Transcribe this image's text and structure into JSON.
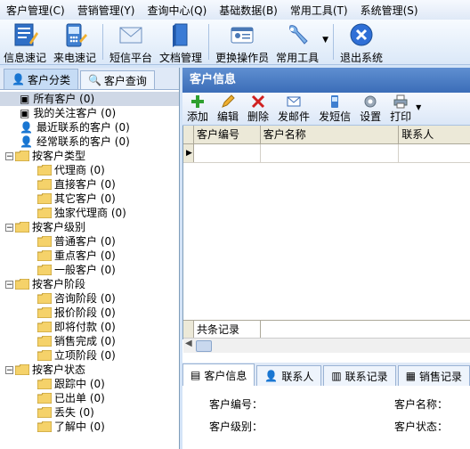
{
  "menu": [
    "客户管理(C)",
    "营销管理(Y)",
    "查询中心(Q)",
    "基础数据(B)",
    "常用工具(T)",
    "系统管理(S)"
  ],
  "toolbar": {
    "buttons": [
      {
        "label": "信息速记",
        "icon": "note-pen-icon"
      },
      {
        "label": "来电速记",
        "icon": "phone-icon"
      },
      {
        "label": "短信平台",
        "icon": "envelope-icon"
      },
      {
        "label": "文档管理",
        "icon": "document-icon"
      },
      {
        "label": "更换操作员",
        "icon": "id-card-icon"
      },
      {
        "label": "常用工具",
        "icon": "wrench-icon"
      },
      {
        "label": "退出系统",
        "icon": "exit-icon"
      }
    ]
  },
  "left_tabs": [
    "客户分类",
    "客户查询"
  ],
  "tree": {
    "top": [
      "所有客户 (0)",
      "我的关注客户 (0)",
      "最近联系的客户 (0)",
      "经常联系的客户 (0)"
    ],
    "groups": [
      {
        "title": "按客户类型",
        "children": [
          "代理商 (0)",
          "直接客户 (0)",
          "其它客户 (0)",
          "独家代理商 (0)"
        ]
      },
      {
        "title": "按客户级别",
        "children": [
          "普通客户 (0)",
          "重点客户 (0)",
          "一般客户 (0)"
        ]
      },
      {
        "title": "按客户阶段",
        "children": [
          "咨询阶段 (0)",
          "报价阶段 (0)",
          "即将付款 (0)",
          "销售完成 (0)",
          "立项阶段 (0)"
        ]
      },
      {
        "title": "按客户状态",
        "children": [
          "跟踪中 (0)",
          "已出单 (0)",
          "丢失 (0)",
          "了解中 (0)"
        ]
      }
    ]
  },
  "right_panel": {
    "title": "客户信息",
    "tools": [
      {
        "label": "添加",
        "icon": "plus-icon"
      },
      {
        "label": "编辑",
        "icon": "pencil-icon"
      },
      {
        "label": "删除",
        "icon": "delete-x-icon"
      },
      {
        "label": "发邮件",
        "icon": "mail-icon"
      },
      {
        "label": "发短信",
        "icon": "sms-icon"
      },
      {
        "label": "设置",
        "icon": "gear-icon"
      },
      {
        "label": "打印",
        "icon": "printer-icon"
      }
    ],
    "columns": [
      "客户编号",
      "客户名称",
      "联系人"
    ],
    "footer_label": "共条记录",
    "bottom_tabs": [
      "客户信息",
      "联系人",
      "联系记录",
      "销售记录"
    ],
    "detail": {
      "customer_no": "客户编号：",
      "customer_name": "客户名称：",
      "customer_level": "客户级别：",
      "customer_status": "客户状态："
    }
  }
}
